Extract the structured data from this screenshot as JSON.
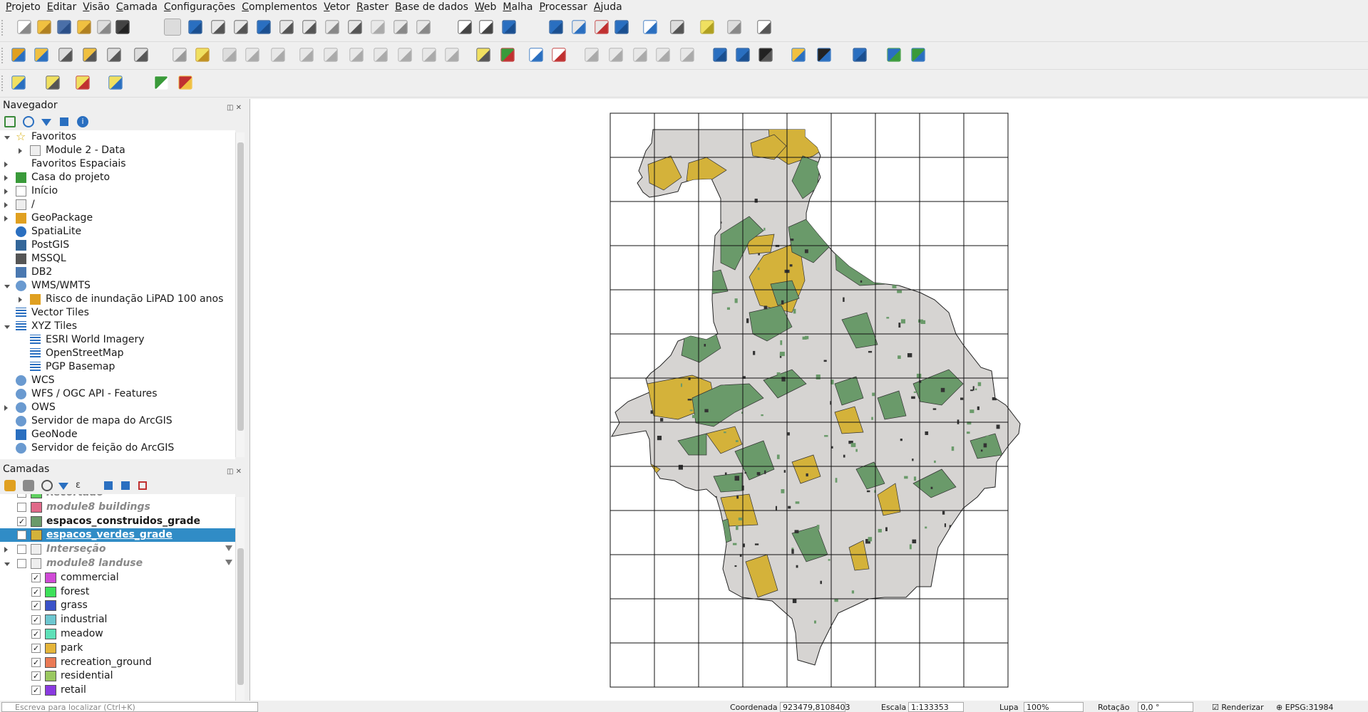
{
  "menu": [
    "Projeto",
    "Editar",
    "Visão",
    "Camada",
    "Configurações",
    "Complementos",
    "Vetor",
    "Raster",
    "Base de dados",
    "Web",
    "Malha",
    "Processar",
    "Ajuda"
  ],
  "navigator": {
    "title": "Navegador",
    "items": [
      {
        "label": "Favoritos",
        "arrow": "open",
        "icon": "star-icon",
        "indent": 0
      },
      {
        "label": "Module 2 - Data",
        "arrow": "closed",
        "icon": "folder-icon",
        "indent": 1
      },
      {
        "label": "Favoritos Espaciais",
        "arrow": "closed",
        "icon": "",
        "indent": 0
      },
      {
        "label": "Casa do projeto",
        "arrow": "closed",
        "icon": "project-home-icon",
        "indent": 0
      },
      {
        "label": "Início",
        "arrow": "closed",
        "icon": "home-icon",
        "indent": 0
      },
      {
        "label": "/",
        "arrow": "closed",
        "icon": "folder-icon",
        "indent": 0
      },
      {
        "label": "GeoPackage",
        "arrow": "closed",
        "icon": "geopackage-icon",
        "indent": 0
      },
      {
        "label": "SpatiaLite",
        "arrow": "",
        "icon": "spatialite-icon",
        "indent": 0
      },
      {
        "label": "PostGIS",
        "arrow": "",
        "icon": "postgis-icon",
        "indent": 0
      },
      {
        "label": "MSSQL",
        "arrow": "",
        "icon": "mssql-icon",
        "indent": 0
      },
      {
        "label": "DB2",
        "arrow": "",
        "icon": "db2-icon",
        "indent": 0
      },
      {
        "label": "WMS/WMTS",
        "arrow": "open",
        "icon": "globe-icon",
        "indent": 0
      },
      {
        "label": "Risco de inundação LiPAD 100 anos",
        "arrow": "closed",
        "icon": "wms-layer-icon",
        "indent": 1
      },
      {
        "label": "Vector Tiles",
        "arrow": "",
        "icon": "grid-icon",
        "indent": 0
      },
      {
        "label": "XYZ Tiles",
        "arrow": "open",
        "icon": "grid-icon",
        "indent": 0
      },
      {
        "label": "ESRI World Imagery",
        "arrow": "",
        "icon": "grid-icon",
        "indent": 1
      },
      {
        "label": "OpenStreetMap",
        "arrow": "",
        "icon": "grid-icon",
        "indent": 1
      },
      {
        "label": "PGP Basemap",
        "arrow": "",
        "icon": "grid-icon",
        "indent": 1
      },
      {
        "label": "WCS",
        "arrow": "",
        "icon": "globe-icon",
        "indent": 0
      },
      {
        "label": "WFS / OGC API - Features",
        "arrow": "",
        "icon": "globe-icon",
        "indent": 0
      },
      {
        "label": "OWS",
        "arrow": "closed",
        "icon": "globe-icon",
        "indent": 0
      },
      {
        "label": "Servidor de mapa do ArcGIS",
        "arrow": "",
        "icon": "globe-icon",
        "indent": 0
      },
      {
        "label": "GeoNode",
        "arrow": "",
        "icon": "geonode-icon",
        "indent": 0
      },
      {
        "label": "Servidor de feição do ArcGIS",
        "arrow": "",
        "icon": "globe-icon",
        "indent": 0
      }
    ]
  },
  "layers": {
    "title": "Camadas",
    "items": [
      {
        "label": "Recortado",
        "checked": false,
        "color": "#5fcf5f",
        "indent": 0,
        "style": "italic-grey",
        "arrow": ""
      },
      {
        "label": "module8 buildings",
        "checked": false,
        "color": "#e06a8a",
        "indent": 0,
        "style": "italic-grey",
        "arrow": ""
      },
      {
        "label": "espacos_construidos_grade",
        "checked": true,
        "color": "#6a9a6a",
        "indent": 0,
        "style": "bold",
        "arrow": ""
      },
      {
        "label": "espacos_verdes_grade",
        "checked": true,
        "color": "#d4b23a",
        "indent": 0,
        "style": "selected",
        "arrow": ""
      },
      {
        "label": "Interseção",
        "checked": false,
        "color": "",
        "indent": 0,
        "style": "italic-grey",
        "arrow": "closed"
      },
      {
        "label": "module8 landuse",
        "checked": false,
        "color": "",
        "indent": 0,
        "style": "italic-grey",
        "arrow": "open"
      },
      {
        "label": "commercial",
        "checked": true,
        "color": "#d04ad6",
        "indent": 1,
        "style": "",
        "arrow": ""
      },
      {
        "label": "forest",
        "checked": true,
        "color": "#3ee05a",
        "indent": 1,
        "style": "",
        "arrow": ""
      },
      {
        "label": "grass",
        "checked": true,
        "color": "#3a52c8",
        "indent": 1,
        "style": "",
        "arrow": ""
      },
      {
        "label": "industrial",
        "checked": true,
        "color": "#6ec7d0",
        "indent": 1,
        "style": "",
        "arrow": ""
      },
      {
        "label": "meadow",
        "checked": true,
        "color": "#5ee0b8",
        "indent": 1,
        "style": "",
        "arrow": ""
      },
      {
        "label": "park",
        "checked": true,
        "color": "#e5b53a",
        "indent": 1,
        "style": "",
        "arrow": ""
      },
      {
        "label": "recreation_ground",
        "checked": true,
        "color": "#ea7a55",
        "indent": 1,
        "style": "",
        "arrow": ""
      },
      {
        "label": "residential",
        "checked": true,
        "color": "#9ac860",
        "indent": 1,
        "style": "",
        "arrow": ""
      },
      {
        "label": "retail",
        "checked": true,
        "color": "#8a3ae0",
        "indent": 1,
        "style": "",
        "arrow": ""
      }
    ]
  },
  "status": {
    "search_placeholder": "Escreva para localizar (Ctrl+K)",
    "coord_label": "Coordenada",
    "coord_value": "923479,8108403",
    "scale_label": "Escala",
    "scale_value": "1:133353",
    "lupa_label": "Lupa",
    "lupa_value": "100%",
    "rotation_label": "Rotação",
    "rotation_value": "0,0 °",
    "render_label": "Renderizar",
    "crs": "EPSG:31984"
  },
  "colors": {
    "park": "#d4b23a",
    "built": "#6a9a6a",
    "base": "#d6d4d2",
    "selected": "#308cc6"
  }
}
